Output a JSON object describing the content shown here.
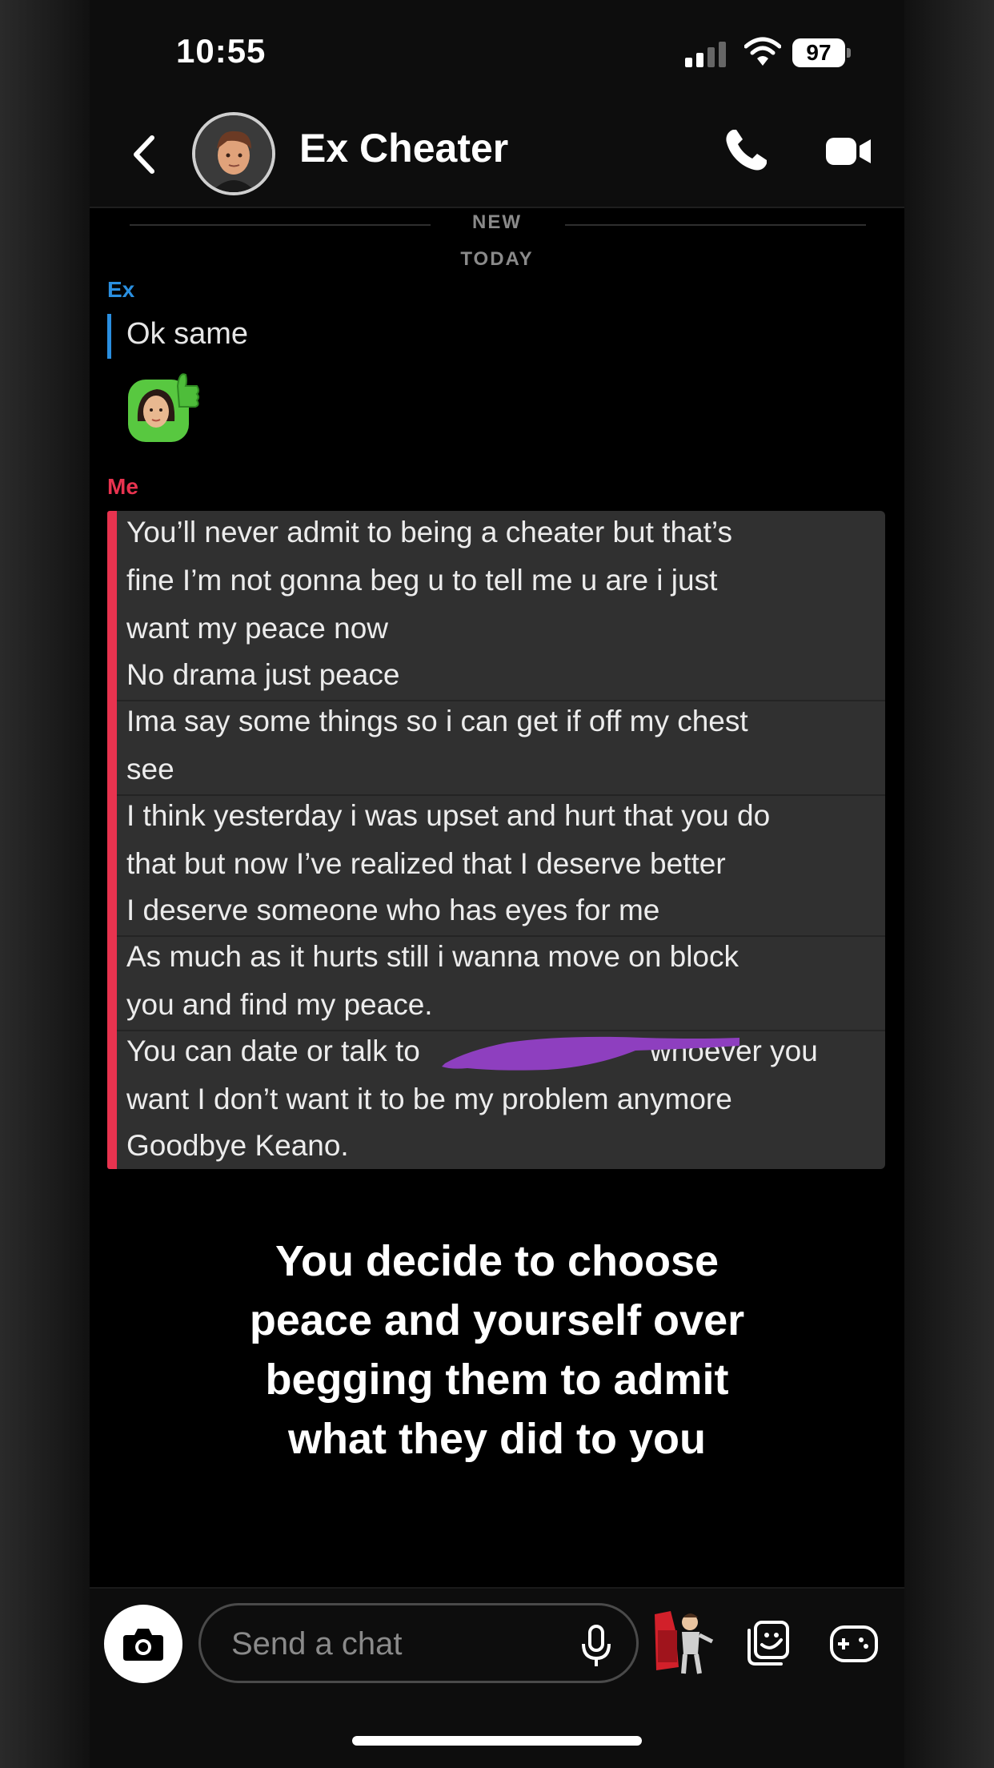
{
  "status_bar": {
    "time": "10:55",
    "battery": "97"
  },
  "header": {
    "contact_name": "Ex Cheater"
  },
  "divider": {
    "new_label": "NEW",
    "today_label": "TODAY"
  },
  "messages": {
    "ex": {
      "sender": "Ex",
      "text": "Ok same"
    },
    "me": {
      "sender": "Me",
      "lines": [
        "You’ll never admit to being a cheater but that’s",
        "fine I’m not gonna beg u to tell me u are i just",
        "want my peace now",
        "No drama just peace",
        "Ima say some things so i can get if off my chest",
        "see",
        "I think yesterday i was upset and hurt that you do",
        "that but now I’ve realized that I deserve better",
        "I deserve someone who has eyes for me",
        "As much as it hurts still i wanna move on block",
        "you and find my peace.",
        "You can date or talk to",
        "whoever you",
        "want I don’t want it to be my problem anymore",
        "Goodbye Keano."
      ]
    }
  },
  "caption": {
    "lines": [
      "You decide to choose",
      "peace and yourself over",
      "begging them to admit",
      "what they did to you"
    ]
  },
  "chat_bar": {
    "placeholder": "Send a chat"
  },
  "colors": {
    "ex_accent": "#2a8fe0",
    "me_accent": "#e8334f",
    "redaction": "#8e3fbf"
  }
}
